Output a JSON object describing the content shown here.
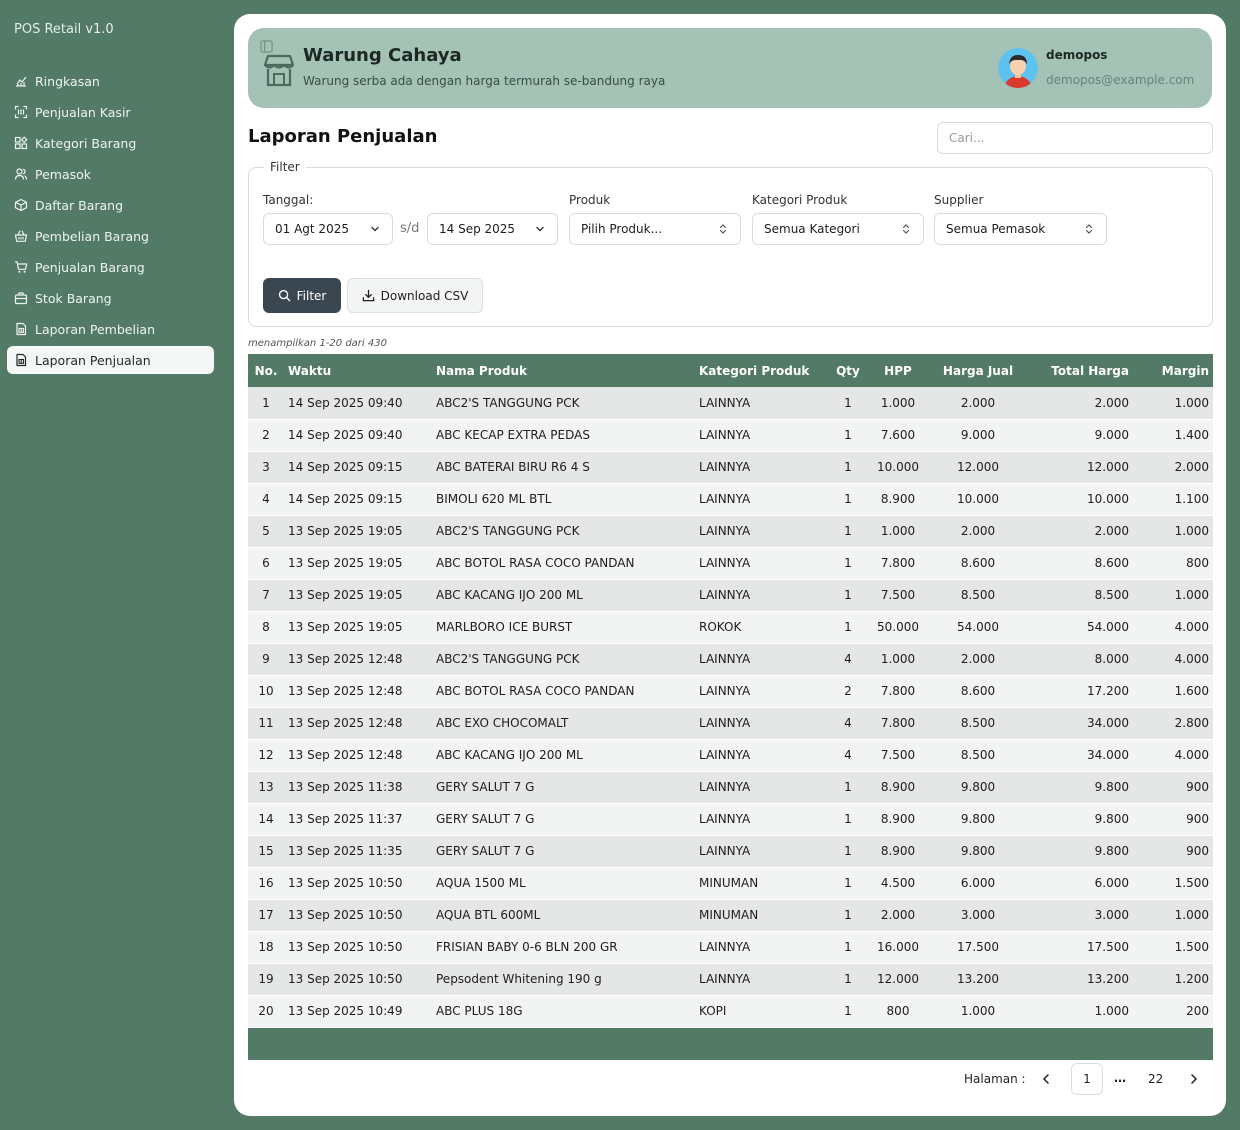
{
  "app": {
    "title": "POS Retail v1.0"
  },
  "sidebar": {
    "items": [
      {
        "label": "Ringkasan",
        "icon": "chart-icon"
      },
      {
        "label": "Penjualan Kasir",
        "icon": "scan-icon"
      },
      {
        "label": "Kategori Barang",
        "icon": "category-icon"
      },
      {
        "label": "Pemasok",
        "icon": "users-icon"
      },
      {
        "label": "Daftar Barang",
        "icon": "box-icon"
      },
      {
        "label": "Pembelian Barang",
        "icon": "basket-icon"
      },
      {
        "label": "Penjualan Barang",
        "icon": "cart-icon"
      },
      {
        "label": "Stok Barang",
        "icon": "briefcase-icon"
      },
      {
        "label": "Laporan Pembelian",
        "icon": "report-icon"
      },
      {
        "label": "Laporan Penjualan",
        "icon": "report-icon",
        "active": true
      }
    ]
  },
  "header": {
    "store_name": "Warung Cahaya",
    "tagline": "Warung serba ada dengan harga termurah se-bandung raya",
    "user_name": "demopos",
    "user_email": "demopos@example.com",
    "banner_color": "#a4c2b6"
  },
  "page": {
    "title": "Laporan Penjualan",
    "search_placeholder": "Cari..."
  },
  "filter": {
    "legend": "Filter",
    "date_label": "Tanggal:",
    "date_from": "01 Agt 2025",
    "date_separator": "s/d",
    "date_to": "14 Sep 2025",
    "product_label": "Produk",
    "product_value": "Pilih Produk...",
    "category_label": "Kategori Produk",
    "category_value": "Semua Kategori",
    "supplier_label": "Supplier",
    "supplier_value": "Semua Pemasok",
    "filter_button": "Filter",
    "csv_button": "Download CSV"
  },
  "table": {
    "showing_text": "menampilkan 1-20 dari 430",
    "header_color": "#527a67",
    "columns": [
      "No.",
      "Waktu",
      "Nama Produk",
      "Kategori Produk",
      "Qty",
      "HPP",
      "Harga Jual",
      "Total Harga",
      "Margin"
    ],
    "rows": [
      [
        "1",
        "14 Sep 2025 09:40",
        "ABC2'S TANGGUNG PCK",
        "LAINNYA",
        "1",
        "1.000",
        "2.000",
        "2.000",
        "1.000"
      ],
      [
        "2",
        "14 Sep 2025 09:40",
        "ABC KECAP EXTRA PEDAS",
        "LAINNYA",
        "1",
        "7.600",
        "9.000",
        "9.000",
        "1.400"
      ],
      [
        "3",
        "14 Sep 2025 09:15",
        "ABC BATERAI BIRU R6 4 S",
        "LAINNYA",
        "1",
        "10.000",
        "12.000",
        "12.000",
        "2.000"
      ],
      [
        "4",
        "14 Sep 2025 09:15",
        "BIMOLI 620 ML BTL",
        "LAINNYA",
        "1",
        "8.900",
        "10.000",
        "10.000",
        "1.100"
      ],
      [
        "5",
        "13 Sep 2025 19:05",
        "ABC2'S TANGGUNG PCK",
        "LAINNYA",
        "1",
        "1.000",
        "2.000",
        "2.000",
        "1.000"
      ],
      [
        "6",
        "13 Sep 2025 19:05",
        "ABC BOTOL RASA COCO PANDAN",
        "LAINNYA",
        "1",
        "7.800",
        "8.600",
        "8.600",
        "800"
      ],
      [
        "7",
        "13 Sep 2025 19:05",
        "ABC KACANG IJO 200 ML",
        "LAINNYA",
        "1",
        "7.500",
        "8.500",
        "8.500",
        "1.000"
      ],
      [
        "8",
        "13 Sep 2025 19:05",
        "MARLBORO ICE BURST",
        "ROKOK",
        "1",
        "50.000",
        "54.000",
        "54.000",
        "4.000"
      ],
      [
        "9",
        "13 Sep 2025 12:48",
        "ABC2'S TANGGUNG PCK",
        "LAINNYA",
        "4",
        "1.000",
        "2.000",
        "8.000",
        "4.000"
      ],
      [
        "10",
        "13 Sep 2025 12:48",
        "ABC BOTOL RASA COCO PANDAN",
        "LAINNYA",
        "2",
        "7.800",
        "8.600",
        "17.200",
        "1.600"
      ],
      [
        "11",
        "13 Sep 2025 12:48",
        "ABC EXO CHOCOMALT",
        "LAINNYA",
        "4",
        "7.800",
        "8.500",
        "34.000",
        "2.800"
      ],
      [
        "12",
        "13 Sep 2025 12:48",
        "ABC KACANG IJO 200 ML",
        "LAINNYA",
        "4",
        "7.500",
        "8.500",
        "34.000",
        "4.000"
      ],
      [
        "13",
        "13 Sep 2025 11:38",
        "GERY SALUT 7 G",
        "LAINNYA",
        "1",
        "8.900",
        "9.800",
        "9.800",
        "900"
      ],
      [
        "14",
        "13 Sep 2025 11:37",
        "GERY SALUT 7 G",
        "LAINNYA",
        "1",
        "8.900",
        "9.800",
        "9.800",
        "900"
      ],
      [
        "15",
        "13 Sep 2025 11:35",
        "GERY SALUT 7 G",
        "LAINNYA",
        "1",
        "8.900",
        "9.800",
        "9.800",
        "900"
      ],
      [
        "16",
        "13 Sep 2025 10:50",
        "AQUA 1500 ML",
        "MINUMAN",
        "1",
        "4.500",
        "6.000",
        "6.000",
        "1.500"
      ],
      [
        "17",
        "13 Sep 2025 10:50",
        "AQUA BTL 600ML",
        "MINUMAN",
        "1",
        "2.000",
        "3.000",
        "3.000",
        "1.000"
      ],
      [
        "18",
        "13 Sep 2025 10:50",
        "FRISIAN BABY 0-6 BLN 200 GR",
        "LAINNYA",
        "1",
        "16.000",
        "17.500",
        "17.500",
        "1.500"
      ],
      [
        "19",
        "13 Sep 2025 10:50",
        "Pepsodent Whitening 190 g",
        "LAINNYA",
        "1",
        "12.000",
        "13.200",
        "13.200",
        "1.200"
      ],
      [
        "20",
        "13 Sep 2025 10:49",
        "ABC PLUS 18G",
        "KOPI",
        "1",
        "800",
        "1.000",
        "1.000",
        "200"
      ]
    ]
  },
  "pagination": {
    "label": "Halaman :",
    "current_page": "1",
    "ellipsis": "…",
    "last_page": "22"
  }
}
